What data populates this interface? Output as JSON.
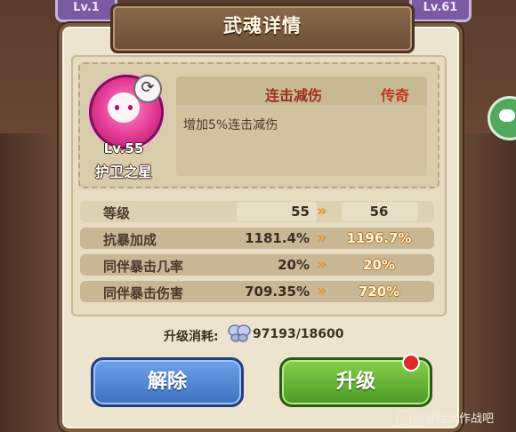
{
  "background": {
    "left_card_text": "Lv.1",
    "right_card_text": "Lv.61"
  },
  "dialog": {
    "title": "武魂详情",
    "item": {
      "level_text": "Lv.55",
      "name": "护卫之星",
      "icon": "pink-spirit-icon",
      "swap_icon": "swap-icon"
    },
    "skill": {
      "name": "连击减伤",
      "rarity": "传奇",
      "description": "增加5%连击减伤"
    },
    "stats": [
      {
        "label": "等级",
        "current": "55",
        "next": "56"
      },
      {
        "label": "抗暴加成",
        "current": "1181.4%",
        "next": "1196.7%"
      },
      {
        "label": "同伴暴击几率",
        "current": "20%",
        "next": "20%"
      },
      {
        "label": "同伴暴击伤害",
        "current": "709.35%",
        "next": "720%"
      }
    ],
    "arrow_glyph": "»",
    "cost": {
      "label": "升级消耗:",
      "icon": "butterfly-material-icon",
      "value": "97193/18600"
    },
    "buttons": {
      "dismiss": "解除",
      "upgrade": "升级"
    }
  },
  "watermark": "@冒险大作战吧",
  "colors": {
    "rarity": "#c0391c",
    "skill_name": "#a0301c",
    "arrow": "#e2952a",
    "button_blue": "#4d7fce",
    "button_green": "#5fae33"
  }
}
